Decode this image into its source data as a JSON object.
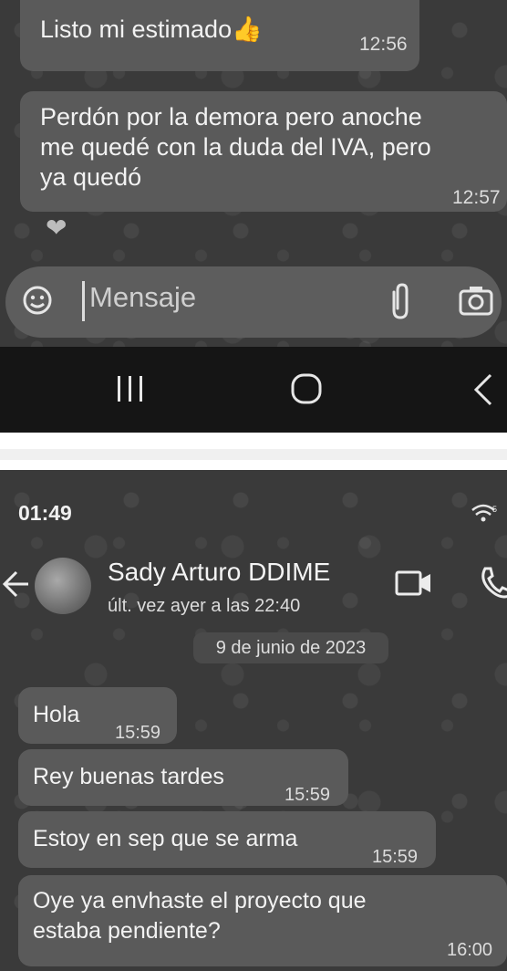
{
  "top_chat": {
    "messages": [
      {
        "text": "Listo mi estimado👍",
        "time": "12:56"
      },
      {
        "text": "Perdón por la demora pero anoche\nme quedé con la duda del IVA, pero\nya quedó",
        "time": "12:57"
      }
    ],
    "reaction": "❤",
    "input_placeholder": "Mensaje"
  },
  "bottom_chat": {
    "status_time": "01:49",
    "contact_name": "Sady Arturo DDIME",
    "last_seen": "últ. vez ayer a las 22:40",
    "date_separator": "9 de junio de 2023",
    "messages": [
      {
        "text": "Hola",
        "time": "15:59"
      },
      {
        "text": "Rey buenas tardes",
        "time": "15:59"
      },
      {
        "text": "Estoy en sep que se arma",
        "time": "15:59"
      },
      {
        "text": "Oye ya envhaste el proyecto que\nestaba pendiente?",
        "time": "16:00"
      }
    ]
  },
  "icons": {
    "emoji": "emoji-icon",
    "attach": "paperclip-icon",
    "camera": "camera-icon",
    "recent": "recent-apps-icon",
    "home": "home-icon",
    "back": "back-icon",
    "video": "video-call-icon",
    "call": "phone-icon",
    "signal": "wifi-signal-icon"
  }
}
